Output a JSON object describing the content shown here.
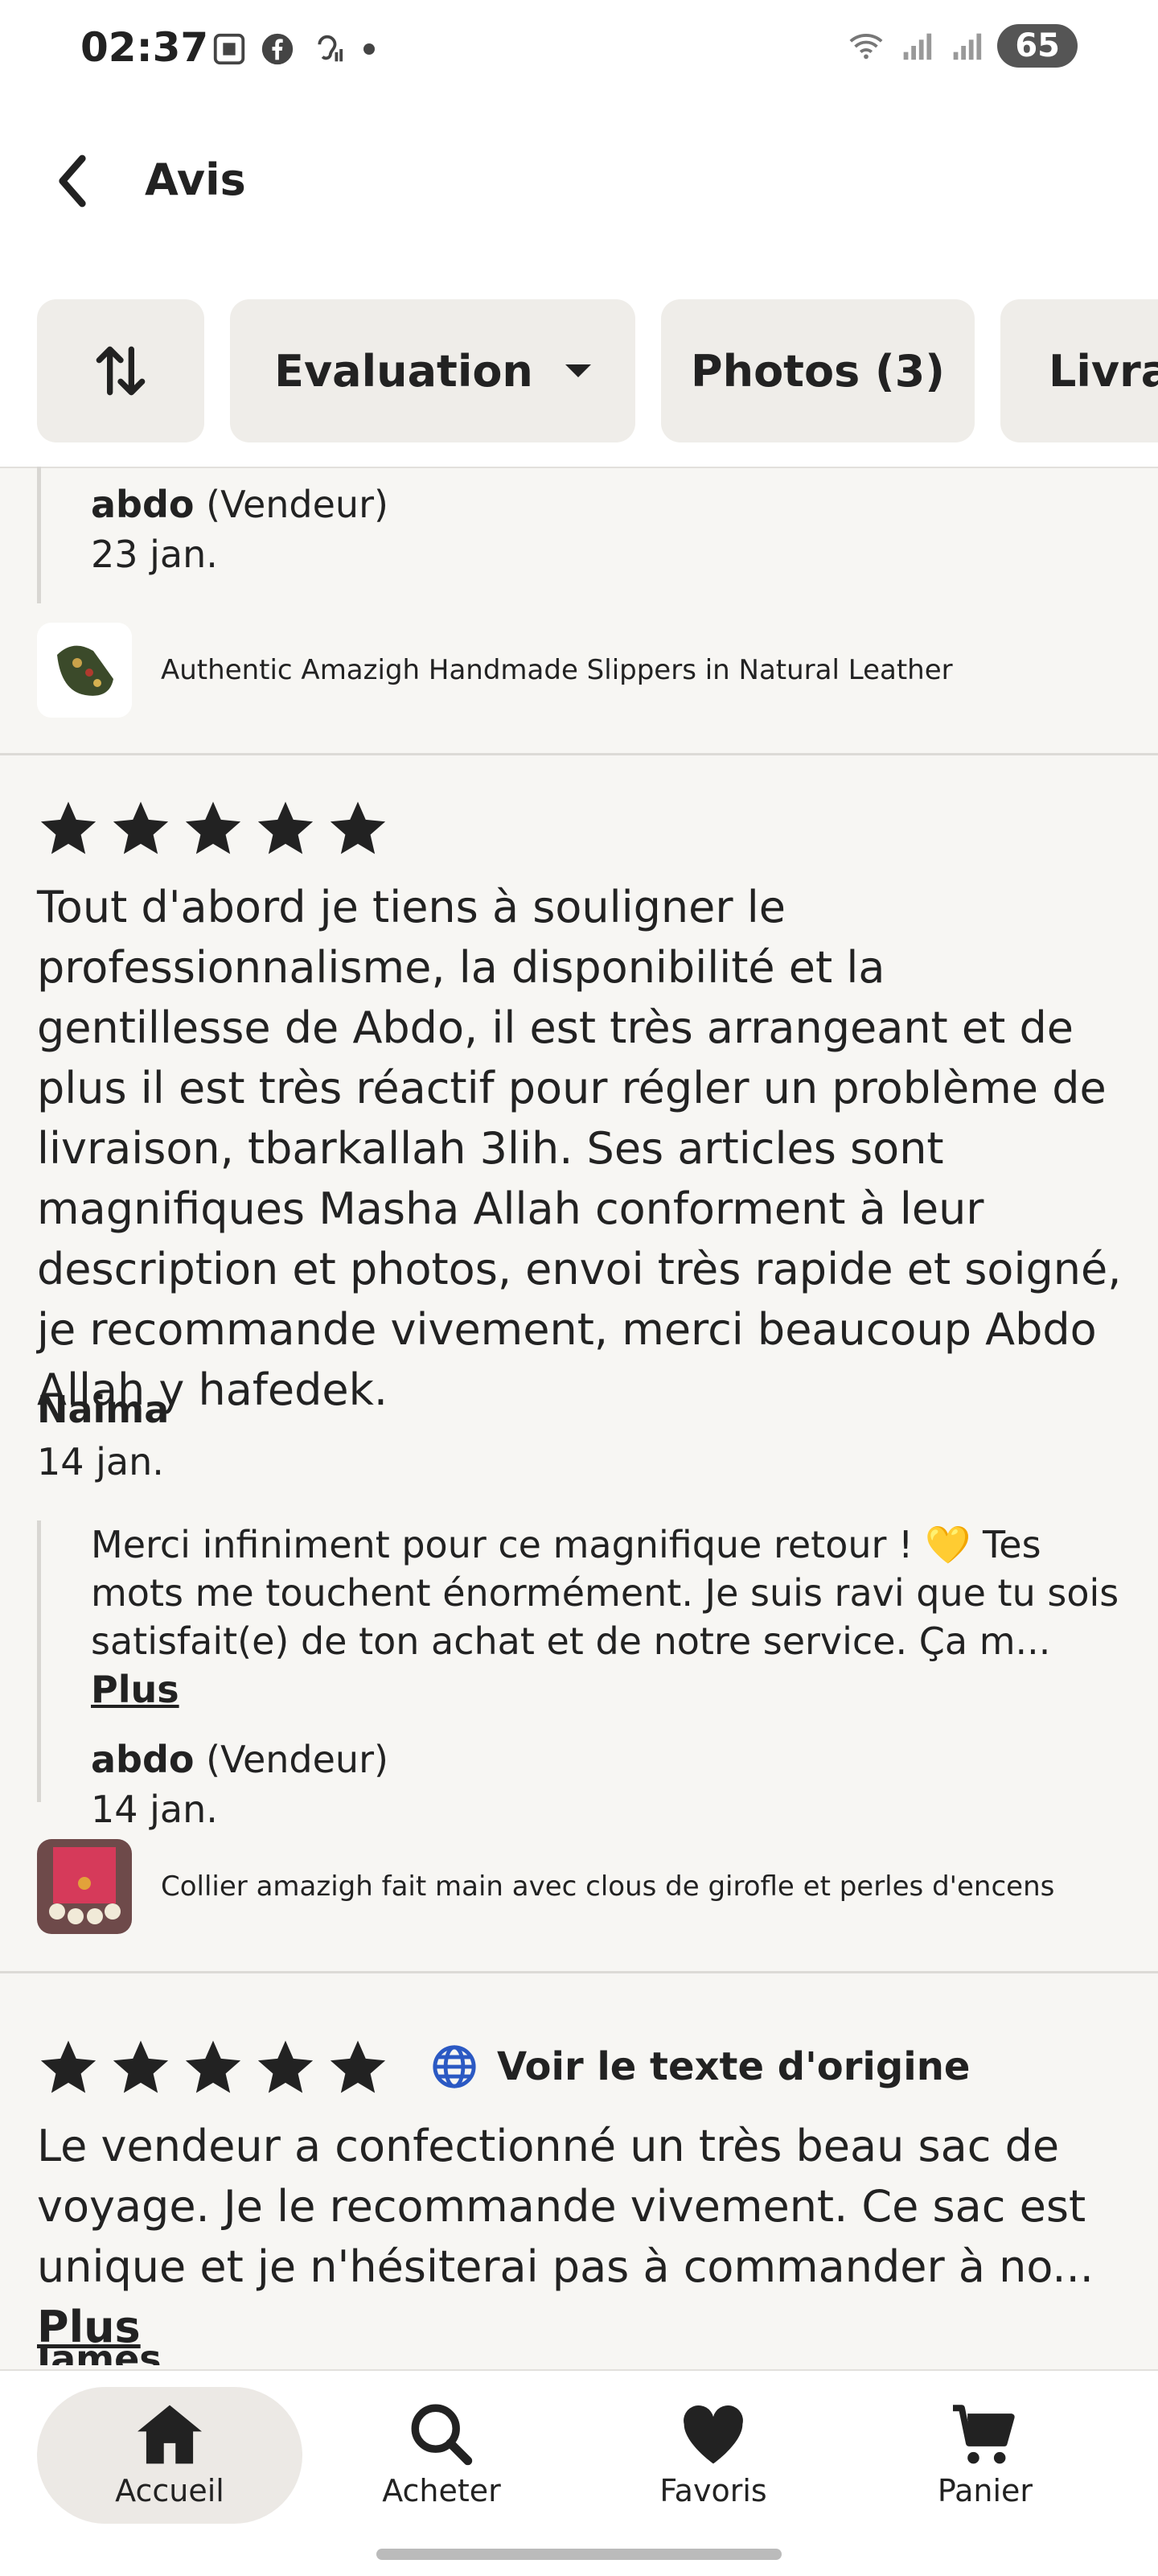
{
  "status": {
    "time": "02:37",
    "battery": "65"
  },
  "header": {
    "title": "Avis"
  },
  "filters": {
    "evaluation": "Evaluation",
    "photos": "Photos (3)",
    "delivery": "Livrai"
  },
  "reviews": [
    {
      "reply": {
        "seller": "abdo",
        "role": "(Vendeur)",
        "date": "23 jan."
      },
      "product": "Authentic Amazigh Handmade Slippers in Natural Leather"
    },
    {
      "text": "Tout d'abord je tiens à souligner le professionnalisme, la disponibilité et la gentillesse de Abdo, il est très arrangeant et de plus il est très réactif pour régler un problème de livraison, tbarkallah 3lih. Ses articles sont magnifiques Masha Allah conforment à leur description et photos, envoi très rapide et soigné, je recommande vivement, merci beaucoup Abdo Allah y hafedek.",
      "name": "Naima",
      "date": "14 jan.",
      "reply": {
        "text": "Merci infiniment pour ce magnifique retour ! 💛 Tes mots me touchent énormément. Je suis ravi que tu sois satisfait(e) de ton achat et de notre service. Ça m...",
        "more": "Plus",
        "seller": "abdo",
        "role": "(Vendeur)",
        "date": "14 jan."
      },
      "product": "Collier amazigh fait main avec clous de girofle et perles d'encens"
    },
    {
      "original_link": "Voir le texte d'origine",
      "text": "Le vendeur a confectionné un très beau sac de voyage. Je le recommande vivement. Ce sac est unique et je n'hésiterai pas à commander à no...",
      "more": "Plus",
      "name": "James"
    }
  ],
  "nav": {
    "home": "Accueil",
    "shop": "Acheter",
    "favorites": "Favoris",
    "cart": "Panier"
  }
}
